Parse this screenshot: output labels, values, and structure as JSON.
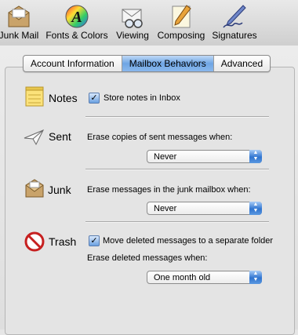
{
  "toolbar": {
    "items": [
      {
        "label": "Junk Mail",
        "icon": "junk-mail-icon"
      },
      {
        "label": "Fonts & Colors",
        "icon": "fonts-colors-icon"
      },
      {
        "label": "Viewing",
        "icon": "viewing-icon"
      },
      {
        "label": "Composing",
        "icon": "composing-icon"
      },
      {
        "label": "Signatures",
        "icon": "signatures-icon"
      }
    ]
  },
  "tabs": [
    {
      "label": "Account Information",
      "selected": false
    },
    {
      "label": "Mailbox Behaviors",
      "selected": true
    },
    {
      "label": "Advanced",
      "selected": false
    }
  ],
  "sections": {
    "notes": {
      "title": "Notes",
      "checkbox_label": "Store notes in Inbox",
      "checked": true
    },
    "sent": {
      "title": "Sent",
      "prompt": "Erase copies of sent messages when:",
      "selected": "Never"
    },
    "junk": {
      "title": "Junk",
      "prompt": "Erase messages in the junk mailbox when:",
      "selected": "Never"
    },
    "trash": {
      "title": "Trash",
      "checkbox_label": "Move deleted messages to a separate folder",
      "checked": true,
      "prompt": "Erase deleted messages when:",
      "selected": "One month old"
    }
  },
  "colors": {
    "accent": "#3b7ddb",
    "tab_selected": "#8ab8ec"
  }
}
